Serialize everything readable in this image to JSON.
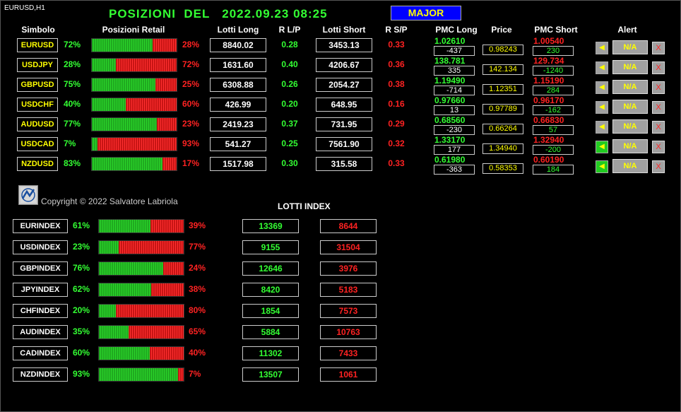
{
  "chart_label": "EURUSD,H1",
  "title": "POSIZIONI  DEL   2022.09.23 08:25",
  "group_button": "MAJOR",
  "headers": {
    "simbolo": "Simbolo",
    "posizioni": "Posizioni Retail",
    "lotti_long": "Lotti Long",
    "r_lp": "R L/P",
    "lotti_short": "Lotti Short",
    "r_sp": "R S/P",
    "pmc_long": "PMC Long",
    "price": "Price",
    "pmc_short": "PMC Short",
    "alert": "Alert"
  },
  "colors": {
    "long": "#33ff33",
    "short": "#ff2222",
    "symbol": "#ffff00",
    "group_bg": "#0000ff"
  },
  "pairs": [
    {
      "symbol": "EURUSD",
      "long_pct": "72%",
      "long_val": 72,
      "short_pct": "28%",
      "lotti_long": "8840.02",
      "r_lp": "0.28",
      "lotti_short": "3453.13",
      "r_sp": "0.33",
      "pmc_long": "1.02610",
      "pmc_long_diff": "-437",
      "price": "0.98243",
      "pmc_short": "1.00540",
      "pmc_short_diff": "230",
      "alert_icon": "bell-icon",
      "alert_active": false,
      "na": "N/A",
      "x": "X"
    },
    {
      "symbol": "USDJPY",
      "long_pct": "28%",
      "long_val": 28,
      "short_pct": "72%",
      "lotti_long": "1631.60",
      "r_lp": "0.40",
      "lotti_short": "4206.67",
      "r_sp": "0.36",
      "pmc_long": "138.781",
      "pmc_long_diff": "335",
      "price": "142.134",
      "pmc_short": "129.734",
      "pmc_short_diff": "-1240",
      "alert_icon": "bell-icon",
      "alert_active": false,
      "na": "N/A",
      "x": "X"
    },
    {
      "symbol": "GBPUSD",
      "long_pct": "75%",
      "long_val": 75,
      "short_pct": "25%",
      "lotti_long": "6308.88",
      "r_lp": "0.26",
      "lotti_short": "2054.27",
      "r_sp": "0.38",
      "pmc_long": "1.19490",
      "pmc_long_diff": "-714",
      "price": "1.12351",
      "pmc_short": "1.15190",
      "pmc_short_diff": "284",
      "alert_icon": "bell-icon",
      "alert_active": false,
      "na": "N/A",
      "x": "X"
    },
    {
      "symbol": "USDCHF",
      "long_pct": "40%",
      "long_val": 40,
      "short_pct": "60%",
      "lotti_long": "426.99",
      "r_lp": "0.20",
      "lotti_short": "648.95",
      "r_sp": "0.16",
      "pmc_long": "0.97660",
      "pmc_long_diff": "13",
      "price": "0.97789",
      "pmc_short": "0.96170",
      "pmc_short_diff": "-162",
      "alert_icon": "bell-icon",
      "alert_active": false,
      "na": "N/A",
      "x": "X"
    },
    {
      "symbol": "AUDUSD",
      "long_pct": "77%",
      "long_val": 77,
      "short_pct": "23%",
      "lotti_long": "2419.23",
      "r_lp": "0.37",
      "lotti_short": "731.95",
      "r_sp": "0.29",
      "pmc_long": "0.68560",
      "pmc_long_diff": "-230",
      "price": "0.66264",
      "pmc_short": "0.66830",
      "pmc_short_diff": "57",
      "alert_icon": "bell-icon",
      "alert_active": false,
      "na": "N/A",
      "x": "X"
    },
    {
      "symbol": "USDCAD",
      "long_pct": "7%",
      "long_val": 7,
      "short_pct": "93%",
      "lotti_long": "541.27",
      "r_lp": "0.25",
      "lotti_short": "7561.90",
      "r_sp": "0.32",
      "pmc_long": "1.33170",
      "pmc_long_diff": "177",
      "price": "1.34940",
      "pmc_short": "1.32940",
      "pmc_short_diff": "-200",
      "alert_icon": "bell-icon",
      "alert_active": true,
      "na": "N/A",
      "x": "X"
    },
    {
      "symbol": "NZDUSD",
      "long_pct": "83%",
      "long_val": 83,
      "short_pct": "17%",
      "lotti_long": "1517.98",
      "r_lp": "0.30",
      "lotti_short": "315.58",
      "r_sp": "0.33",
      "pmc_long": "0.61980",
      "pmc_long_diff": "-363",
      "price": "0.58353",
      "pmc_short": "0.60190",
      "pmc_short_diff": "184",
      "alert_icon": "bell-icon",
      "alert_active": true,
      "na": "N/A",
      "x": "X"
    }
  ],
  "copyright": "Copyright © 2022 Salvatore Labriola",
  "lotti_index_title": "LOTTI INDEX",
  "indexes": [
    {
      "symbol": "EURINDEX",
      "long_pct": "61%",
      "long_val": 61,
      "short_pct": "39%",
      "lotti_long": "13369",
      "lotti_short": "8644"
    },
    {
      "symbol": "USDINDEX",
      "long_pct": "23%",
      "long_val": 23,
      "short_pct": "77%",
      "lotti_long": "9155",
      "lotti_short": "31504"
    },
    {
      "symbol": "GBPINDEX",
      "long_pct": "76%",
      "long_val": 76,
      "short_pct": "24%",
      "lotti_long": "12646",
      "lotti_short": "3976"
    },
    {
      "symbol": "JPYINDEX",
      "long_pct": "62%",
      "long_val": 62,
      "short_pct": "38%",
      "lotti_long": "8420",
      "lotti_short": "5183"
    },
    {
      "symbol": "CHFINDEX",
      "long_pct": "20%",
      "long_val": 20,
      "short_pct": "80%",
      "lotti_long": "1854",
      "lotti_short": "7573"
    },
    {
      "symbol": "AUDINDEX",
      "long_pct": "35%",
      "long_val": 35,
      "short_pct": "65%",
      "lotti_long": "5884",
      "lotti_short": "10763"
    },
    {
      "symbol": "CADINDEX",
      "long_pct": "60%",
      "long_val": 60,
      "short_pct": "40%",
      "lotti_long": "11302",
      "lotti_short": "7433"
    },
    {
      "symbol": "NZDINDEX",
      "long_pct": "93%",
      "long_val": 93,
      "short_pct": "7%",
      "lotti_long": "13507",
      "lotti_short": "1061"
    }
  ]
}
